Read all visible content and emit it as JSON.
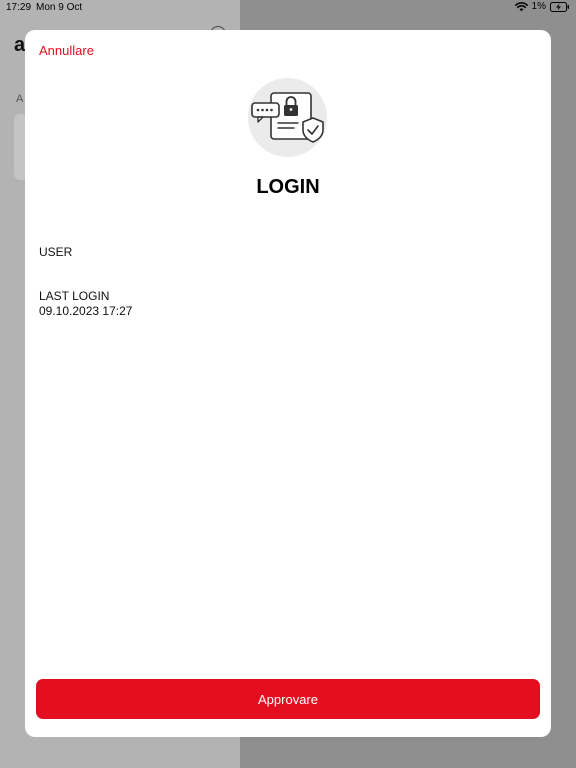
{
  "status_bar": {
    "time": "17:29",
    "date": "Mon 9 Oct",
    "battery": "1%"
  },
  "background_app": {
    "title_fragment": "a",
    "section_fragment": "A"
  },
  "sheet": {
    "cancel_label": "Annullare",
    "title": "LOGIN",
    "hero_icon": "login-security-icon",
    "fields": {
      "user_label": "USER",
      "last_login_label": "LAST LOGIN",
      "last_login_value": "09.10.2023 17:27"
    },
    "approve_label": "Approvare"
  },
  "colors": {
    "accent": "#e30f20",
    "sheet_bg": "#ffffff",
    "overlay": "#8f8f8f"
  }
}
